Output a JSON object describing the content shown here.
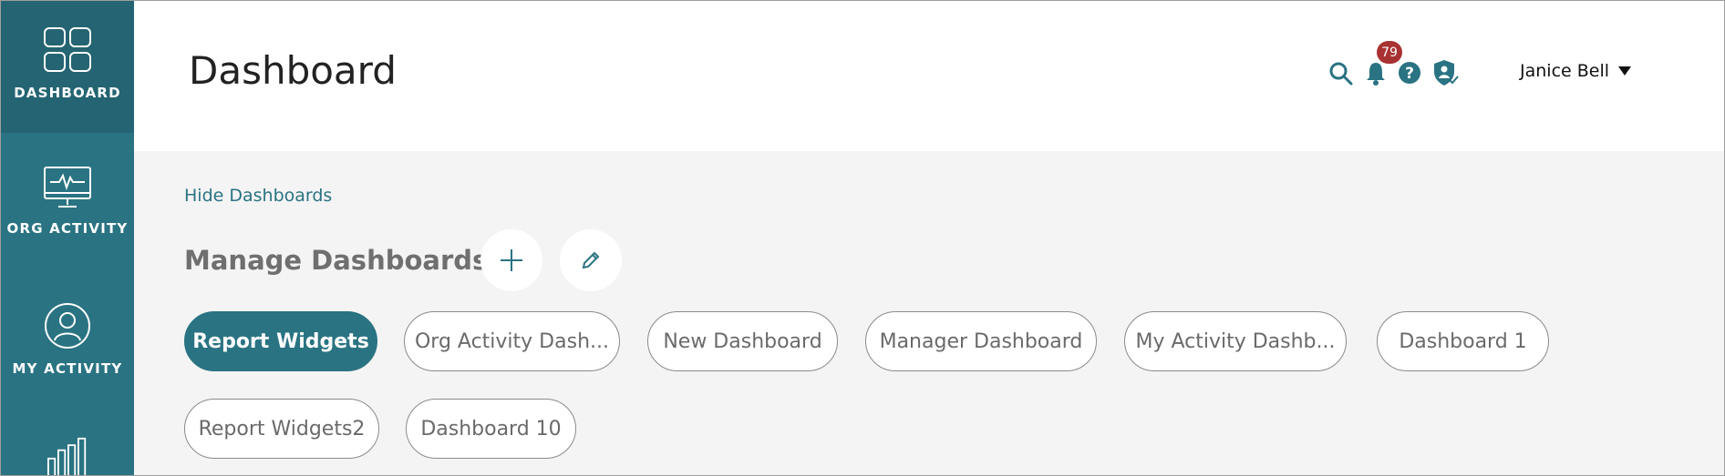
{
  "sidebar": {
    "items": [
      {
        "label": "DASHBOARD",
        "icon": "dashboard-grid-icon"
      },
      {
        "label": "ORG ACTIVITY",
        "icon": "monitor-pulse-icon"
      },
      {
        "label": "MY ACTIVITY",
        "icon": "user-circle-icon"
      },
      {
        "label": "",
        "icon": "bar-chart-icon"
      }
    ]
  },
  "header": {
    "title": "Dashboard",
    "notifications_count": "79",
    "user_name": "Janice Bell"
  },
  "main": {
    "hide_link": "Hide Dashboards",
    "manage_title": "Manage Dashboards",
    "dashboards": [
      {
        "label": "Report Widgets",
        "active": true
      },
      {
        "label": "Org Activity Dash..."
      },
      {
        "label": "New Dashboard"
      },
      {
        "label": "Manager Dashboard"
      },
      {
        "label": "My Activity Dashb..."
      },
      {
        "label": "Dashboard 1"
      },
      {
        "label": "Report Widgets2"
      },
      {
        "label": "Dashboard 10"
      }
    ]
  },
  "colors": {
    "accent": "#2a7382",
    "sidebar_active": "#256472",
    "badge": "#a83232",
    "background": "#f4f4f4"
  }
}
